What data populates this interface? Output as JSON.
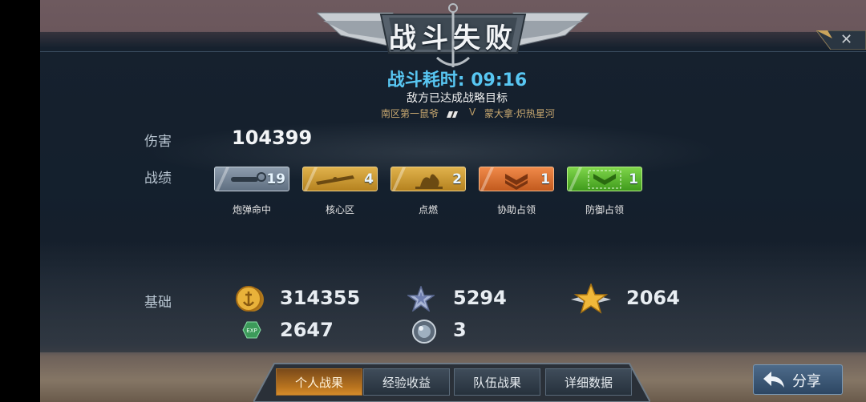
{
  "header": {
    "title": "战斗失败",
    "close_glyph": "✕"
  },
  "battle": {
    "duration": "战斗耗时: 09:16",
    "result_reason": "敌方已达成战略目标",
    "player_left": "南区第一鼠爷",
    "versus": "V",
    "player_right": "蒙大拿·炽热星河"
  },
  "stats": {
    "damage_label": "伤害",
    "damage_value": "104399",
    "record_label": "战绩",
    "badges": [
      {
        "label": "炮弹命中",
        "count": "19",
        "icon": "shell-hit-icon",
        "color": "#6d7f92"
      },
      {
        "label": "核心区",
        "count": "4",
        "icon": "core-zone-icon",
        "color": "#c48a2a"
      },
      {
        "label": "点燃",
        "count": "2",
        "icon": "ignite-icon",
        "color": "#c48a2a"
      },
      {
        "label": "协助占领",
        "count": "1",
        "icon": "assist-capture-icon",
        "color": "#d26a2a"
      },
      {
        "label": "防御占领",
        "count": "1",
        "icon": "defend-capture-icon",
        "color": "#4caf2a"
      }
    ],
    "base_label": "基础",
    "resources": [
      {
        "name": "gold-coin",
        "icon": "gold-anchor-coin-icon",
        "value": "314355"
      },
      {
        "name": "silver-star",
        "icon": "silver-star-icon",
        "value": "5294"
      },
      {
        "name": "winged-gold-star",
        "icon": "winged-gold-star-icon",
        "value": "2064"
      },
      {
        "name": "exp",
        "icon": "exp-hex-icon",
        "value": "2647"
      },
      {
        "name": "orb",
        "icon": "silver-orb-icon",
        "value": "3"
      }
    ]
  },
  "tabs": [
    {
      "label": "个人战果",
      "active": true
    },
    {
      "label": "经验收益",
      "active": false
    },
    {
      "label": "队伍战果",
      "active": false
    },
    {
      "label": "详细数据",
      "active": false
    }
  ],
  "share": {
    "label": "分享"
  },
  "colors": {
    "accent_blue": "#58c6f2",
    "gold_text": "#c8a870"
  }
}
